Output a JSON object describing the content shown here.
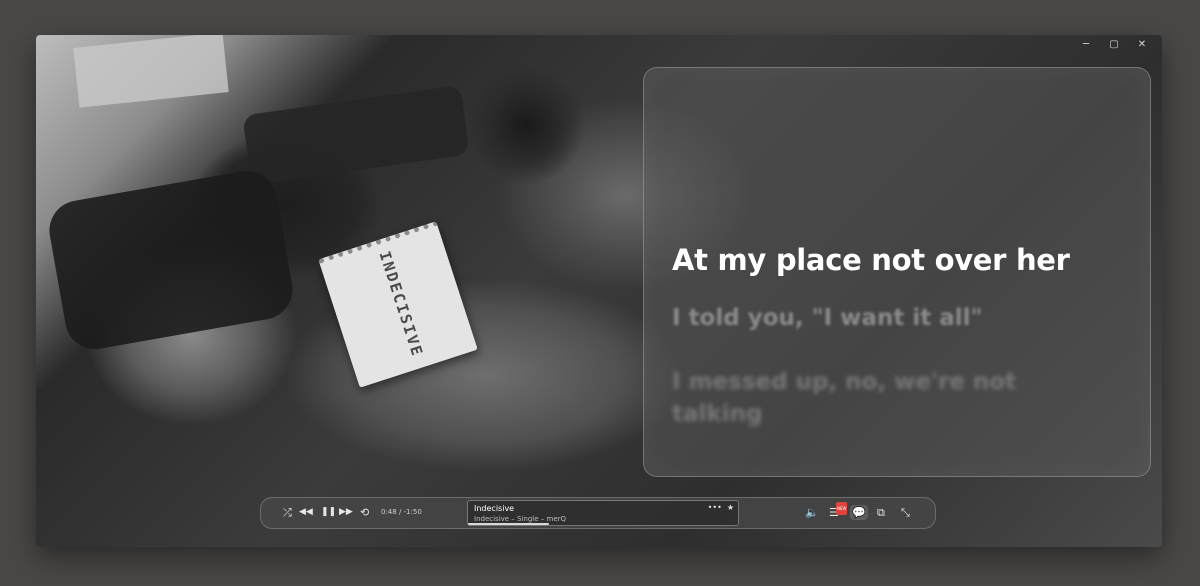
{
  "window": {
    "controls": {
      "minimize_glyph": "─",
      "maximize_glyph": "▢",
      "close_glyph": "✕"
    }
  },
  "artwork": {
    "notebook_text": "INDECISIVE"
  },
  "lyrics": {
    "current": "At my place not over her",
    "next": "I told you, \"I want it all\"",
    "later": "I messed up, no, we're not talking"
  },
  "player": {
    "controls": {
      "shuffle": "⤮",
      "previous": "◀◀",
      "pause": "❚❚",
      "next": "▶▶",
      "repeat": "⟲"
    },
    "time": "0:48 / -1:50",
    "progress": 0.3,
    "track": {
      "title": "Indecisive",
      "subtitle": "Indecisive – Single – merQ",
      "more_glyph": "•••",
      "favorite_glyph": "★"
    },
    "right": {
      "volume": "🔈",
      "queue": "☰",
      "lyrics": "💬",
      "miniplayer": "⧉",
      "collapse": "⤡"
    },
    "queue_badge": "NEW"
  }
}
